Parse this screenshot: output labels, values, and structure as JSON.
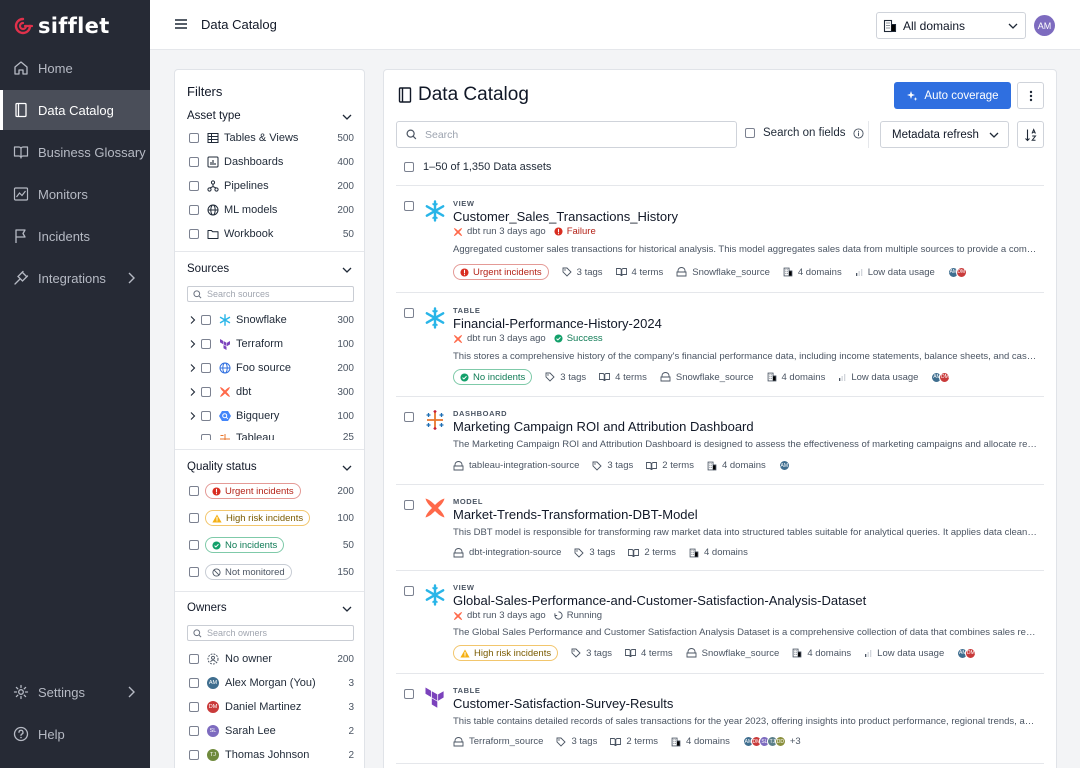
{
  "app": {
    "brand": "sifflet"
  },
  "sidebar": {
    "items": [
      {
        "label": "Home",
        "icon": "home-icon"
      },
      {
        "label": "Data Catalog",
        "icon": "book-icon",
        "active": true
      },
      {
        "label": "Business Glossary",
        "icon": "open-book-icon"
      },
      {
        "label": "Monitors",
        "icon": "monitor-icon"
      },
      {
        "label": "Incidents",
        "icon": "flag-icon"
      },
      {
        "label": "Integrations",
        "icon": "plug-icon",
        "has_submenu": true
      }
    ],
    "bottom": [
      {
        "label": "Settings",
        "icon": "gear-icon",
        "has_submenu": true
      },
      {
        "label": "Help",
        "icon": "help-icon"
      }
    ]
  },
  "topbar": {
    "title": "Data Catalog",
    "domain": "All domains",
    "user_initials": "AM"
  },
  "filters": {
    "title": "Filters",
    "asset_type": {
      "title": "Asset type",
      "items": [
        {
          "label": "Tables & Views",
          "count": "500"
        },
        {
          "label": "Dashboards",
          "count": "400"
        },
        {
          "label": "Pipelines",
          "count": "200"
        },
        {
          "label": "ML models",
          "count": "200"
        },
        {
          "label": "Workbook",
          "count": "50"
        }
      ]
    },
    "sources": {
      "title": "Sources",
      "placeholder": "Search sources",
      "items": [
        {
          "label": "Snowflake",
          "count": "300"
        },
        {
          "label": "Terraform",
          "count": "100"
        },
        {
          "label": "Foo source",
          "count": "200"
        },
        {
          "label": "dbt",
          "count": "300"
        },
        {
          "label": "Bigquery",
          "count": "100"
        },
        {
          "label": "Tableau",
          "count": "25"
        }
      ]
    },
    "quality": {
      "title": "Quality status",
      "items": [
        {
          "label": "Urgent incidents",
          "count": "200"
        },
        {
          "label": "High risk incidents",
          "count": "100"
        },
        {
          "label": "No incidents",
          "count": "50"
        },
        {
          "label": "Not monitored",
          "count": "150"
        }
      ]
    },
    "owners": {
      "title": "Owners",
      "placeholder": "Search owners",
      "items": [
        {
          "label": "No owner",
          "count": "200"
        },
        {
          "label": "Alex Morgan (You)",
          "count": "3",
          "initials": "AM",
          "color": "#3f6e8f"
        },
        {
          "label": "Daniel Martinez",
          "count": "3",
          "initials": "DM",
          "color": "#c93a3a"
        },
        {
          "label": "Sarah Lee",
          "count": "2",
          "initials": "SL",
          "color": "#7d6bbf"
        },
        {
          "label": "Thomas Johnson",
          "count": "2",
          "initials": "TJ",
          "color": "#6f8a3c"
        }
      ]
    }
  },
  "main": {
    "title": "Data Catalog",
    "auto_coverage": "Auto coverage",
    "search_placeholder": "Search",
    "search_on_fields": "Search on fields",
    "metadata_refresh": "Metadata refresh",
    "count_text": "1–50 of 1,350 Data assets",
    "assets": [
      {
        "type": "VIEW",
        "name": "Customer_Sales_Transactions_History",
        "run": "dbt run 3 days ago",
        "status": "Failure",
        "desc": "Aggregated customer sales transactions for historical analysis. This model aggregates sales data from multiple sources to provide a comprehensive view of customer purchasing behavior.",
        "incident": "Urgent incidents",
        "tags": "3 tags",
        "terms": "4 terms",
        "source": "Snowflake_source",
        "domains": "4 domains",
        "usage": "Low data usage",
        "owners": [
          {
            "i": "AM",
            "c": "#3f6e8f"
          },
          {
            "i": "DM",
            "c": "#c93a3a"
          }
        ]
      },
      {
        "type": "TABLE",
        "name": "Financial-Performance-History-2024",
        "run": "dbt run 3 days ago",
        "status": "Success",
        "desc": "This stores a comprehensive history of the company's financial performance data, including income statements, balance sheets, and cash flow statements.",
        "incident": "No incidents",
        "tags": "3 tags",
        "terms": "4 terms",
        "source": "Snowflake_source",
        "domains": "4 domains",
        "usage": "Low data usage",
        "owners": [
          {
            "i": "AM",
            "c": "#3f6e8f"
          },
          {
            "i": "DM",
            "c": "#c93a3a"
          }
        ]
      },
      {
        "type": "DASHBOARD",
        "name": "Marketing Campaign ROI and Attribution Dashboard",
        "desc": "The Marketing Campaign ROI and Attribution Dashboard is designed to assess the effectiveness of marketing campaigns and allocate resources efficiently.",
        "source": "tableau-integration-source",
        "tags": "3 tags",
        "terms": "2 terms",
        "domains": "4 domains",
        "owners": [
          {
            "i": "AM",
            "c": "#3f6e8f"
          }
        ]
      },
      {
        "type": "MODEL",
        "name": "Market-Trends-Transformation-DBT-Model",
        "desc": "This DBT model is responsible for transforming raw market data into structured tables suitable for analytical queries. It applies data cleaning and enrichment steps.",
        "source": "dbt-integration-source",
        "tags": "3 tags",
        "terms": "2 terms",
        "domains": "4 domains"
      },
      {
        "type": "VIEW",
        "name": "Global-Sales-Performance-and-Customer-Satisfaction-Analysis-Dataset",
        "run": "dbt run 3 days ago",
        "status": "Running",
        "desc": "The Global Sales Performance and Customer Satisfaction Analysis Dataset is a comprehensive collection of data that combines sales records with customer feedback.",
        "incident": "High risk incidents",
        "tags": "3 tags",
        "terms": "4 terms",
        "source": "Snowflake_source",
        "domains": "4 domains",
        "usage": "Low data usage",
        "owners": [
          {
            "i": "AM",
            "c": "#3f6e8f"
          },
          {
            "i": "DM",
            "c": "#c93a3a"
          }
        ]
      },
      {
        "type": "TABLE",
        "name": "Customer-Satisfaction-Survey-Results",
        "desc": "This table contains detailed records of sales transactions for the year 2023, offering insights into product performance, regional trends, and customer preferences.",
        "source": "Terraform_source",
        "tags": "3 tags",
        "terms": "2 terms",
        "domains": "4 domains",
        "owners": [
          {
            "i": "AM",
            "c": "#3f6e8f"
          },
          {
            "i": "DM",
            "c": "#c93a3a"
          },
          {
            "i": "SL",
            "c": "#7d6bbf"
          },
          {
            "i": "TJ",
            "c": "#5b7f8a"
          },
          {
            "i": "DD",
            "c": "#8a8f3c"
          }
        ],
        "more_owners": "+3"
      }
    ]
  },
  "colors": {
    "primary": "#2f6fe0",
    "sidebar": "#262a35",
    "brand": "#e0314b"
  }
}
